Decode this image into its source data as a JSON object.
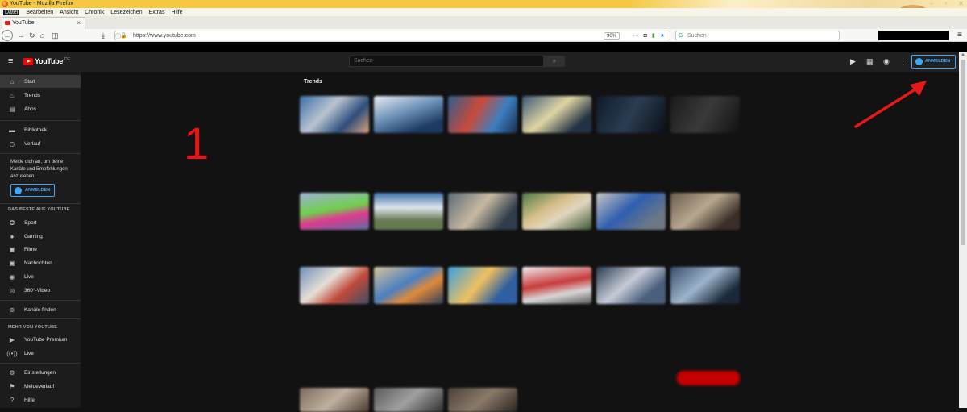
{
  "browser": {
    "window_title": "YouTube - Mozilla Firefox",
    "menu": [
      "Datei",
      "Bearbeiten",
      "Ansicht",
      "Chronik",
      "Lesezeichen",
      "Extras",
      "Hilfe"
    ],
    "tab_title": "YouTube",
    "url": "https://www.youtube.com",
    "zoom": "90%",
    "search_placeholder": "Suchen"
  },
  "youtube": {
    "search_placeholder": "Suchen",
    "signin_label": "ANMELDEN",
    "sidebar": {
      "primary": [
        {
          "label": "Start",
          "icon": "home-icon"
        },
        {
          "label": "Trends",
          "icon": "flame-icon"
        },
        {
          "label": "Abos",
          "icon": "subscriptions-icon"
        }
      ],
      "library": [
        {
          "label": "Bibliothek",
          "icon": "folder-icon"
        },
        {
          "label": "Verlauf",
          "icon": "history-icon"
        }
      ],
      "signin_message": "Melde dich an, um deine Kanäle und Empfehlungen anzusehen.",
      "best_heading": "DAS BESTE AUF YOUTUBE",
      "best": [
        {
          "label": "Sport",
          "icon": "trophy-icon"
        },
        {
          "label": "Gaming",
          "icon": "gamepad-icon"
        },
        {
          "label": "Filme",
          "icon": "film-icon"
        },
        {
          "label": "Nachrichten",
          "icon": "news-icon"
        },
        {
          "label": "Live",
          "icon": "live-icon"
        },
        {
          "label": "360°-Video",
          "icon": "vr-icon"
        }
      ],
      "find_channels": "Kanäle finden",
      "more_heading": "MEHR VON YOUTUBE",
      "more": [
        {
          "label": "YouTube Premium",
          "icon": "youtube-icon"
        },
        {
          "label": "Live",
          "icon": "broadcast-icon"
        }
      ],
      "settings": [
        {
          "label": "Einstellungen",
          "icon": "gear-icon"
        },
        {
          "label": "Meldeverlauf",
          "icon": "flag-icon"
        },
        {
          "label": "Hilfe",
          "icon": "help-icon"
        }
      ]
    },
    "main": {
      "section_title": "Trends"
    }
  },
  "annotations": {
    "number_label": "1",
    "arrow_color": "#e81818"
  }
}
